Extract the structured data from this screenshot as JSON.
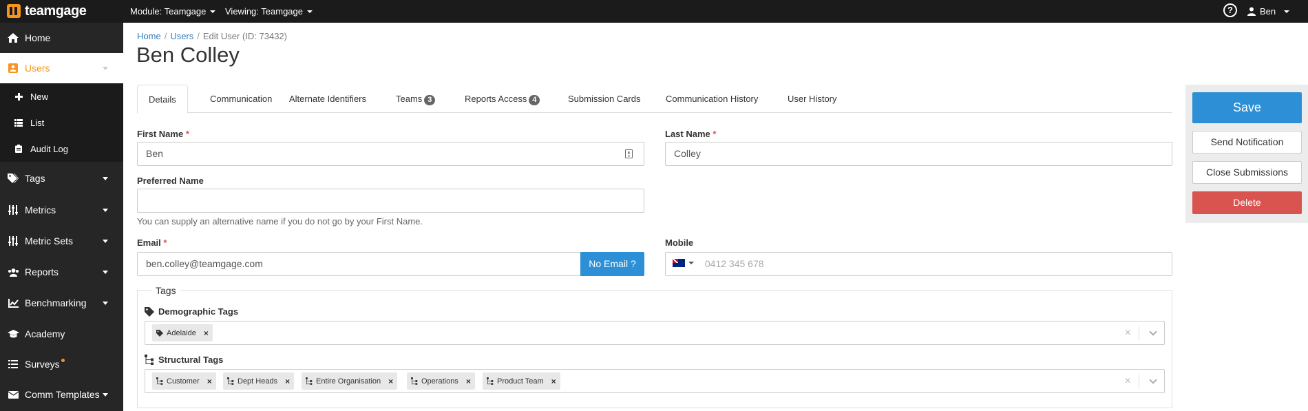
{
  "topbar": {
    "logo_text": "teamgage",
    "module_label": "Module: Teamgage",
    "viewing_label": "Viewing: Teamgage",
    "user_name": "Ben",
    "help_glyph": "?"
  },
  "sidebar": {
    "items": [
      {
        "label": "Home",
        "icon": "home-icon"
      },
      {
        "label": "Users",
        "icon": "user-icon"
      },
      {
        "label": "Tags",
        "icon": "tags-icon"
      },
      {
        "label": "Metrics",
        "icon": "sliders-icon"
      },
      {
        "label": "Metric Sets",
        "icon": "sliders-icon"
      },
      {
        "label": "Reports",
        "icon": "users-icon"
      },
      {
        "label": "Benchmarking",
        "icon": "chart-icon"
      },
      {
        "label": "Academy",
        "icon": "graduation-cap-icon"
      },
      {
        "label": "Surveys",
        "icon": "list-icon"
      },
      {
        "label": "Comm Templates",
        "icon": "envelope-icon"
      }
    ],
    "sub_items": [
      {
        "label": "New",
        "icon": "plus-icon"
      },
      {
        "label": "List",
        "icon": "list-icon"
      },
      {
        "label": "Audit Log",
        "icon": "clipboard-icon"
      }
    ]
  },
  "breadcrumb": {
    "home": "Home",
    "users": "Users",
    "current": "Edit User (ID: 73432)",
    "separator": "/"
  },
  "page_title": "Ben Colley",
  "tabs": [
    {
      "label": "Details",
      "badge": ""
    },
    {
      "label": "Communication",
      "badge": ""
    },
    {
      "label": "Alternate Identifiers",
      "badge": ""
    },
    {
      "label": "Teams",
      "badge": "3"
    },
    {
      "label": "Reports Access",
      "badge": "4"
    },
    {
      "label": "Submission Cards",
      "badge": ""
    },
    {
      "label": "Communication History",
      "badge": ""
    },
    {
      "label": "User History",
      "badge": ""
    }
  ],
  "form": {
    "first_name_label": "First Name",
    "first_name_value": "Ben",
    "last_name_label": "Last Name",
    "last_name_value": "Colley",
    "preferred_name_label": "Preferred Name",
    "preferred_name_value": "",
    "preferred_name_help": "You can supply an alternative name if you do not go by your First Name.",
    "email_label": "Email",
    "email_value": "ben.colley@teamgage.com",
    "no_email_button": "No Email ?",
    "mobile_label": "Mobile",
    "mobile_placeholder": "0412 345 678",
    "required_marker": "*"
  },
  "tags": {
    "legend": "Tags",
    "demographic_label": "Demographic Tags",
    "demographic_values": [
      "Adelaide"
    ],
    "structural_label": "Structural Tags",
    "structural_values": [
      "Customer",
      "Dept Heads",
      "Entire Organisation",
      "Operations",
      "Product Team"
    ],
    "remove_glyph": "×",
    "clear_glyph": "×"
  },
  "actions": {
    "save": "Save",
    "send_notification": "Send Notification",
    "close_submissions": "Close Submissions",
    "delete": "Delete"
  },
  "colors": {
    "accent": "#f7941d",
    "primary": "#2d8fd5",
    "danger": "#d9534f",
    "topbar": "#1b1b1b",
    "sidebar": "#262626"
  }
}
